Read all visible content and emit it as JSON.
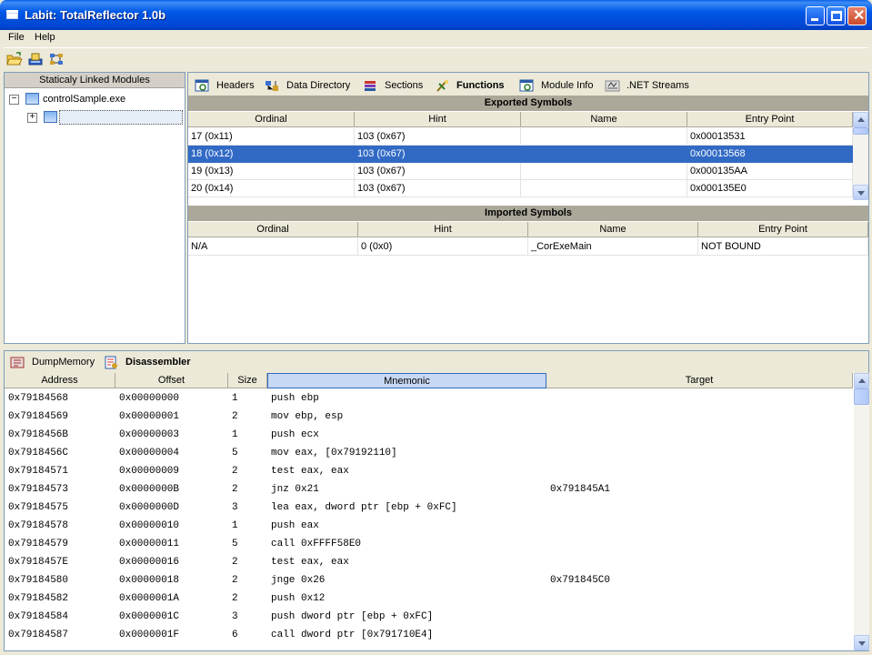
{
  "window": {
    "title": "Labit: TotalReflector 1.0b",
    "icons": {
      "app": "window-icon",
      "minimize": "minimize-icon",
      "maximize": "maximize-icon",
      "close": "close-icon"
    }
  },
  "menu": {
    "file": "File",
    "help": "Help"
  },
  "toolbar": {
    "icons": [
      "open-folder-icon",
      "load-module-icon",
      "reflect-icon"
    ]
  },
  "tree": {
    "header": "Staticaly Linked Modules",
    "root_label": "controlSample.exe",
    "root_expander": "−",
    "child_expander": "+"
  },
  "tabs": [
    {
      "label": "Headers",
      "icon": "headers-icon"
    },
    {
      "label": "Data Directory",
      "icon": "data-directory-icon"
    },
    {
      "label": "Sections",
      "icon": "sections-icon"
    },
    {
      "label": "Functions",
      "icon": "functions-icon"
    },
    {
      "label": "Module Info",
      "icon": "module-info-icon"
    },
    {
      "label": ".NET Streams",
      "icon": "net-streams-icon"
    }
  ],
  "exported": {
    "title": "Exported Symbols",
    "columns": [
      "Ordinal",
      "Hint",
      "Name",
      "Entry Point"
    ],
    "rows": [
      [
        "17 (0x11)",
        "103 (0x67)",
        "",
        "0x00013531"
      ],
      [
        "18 (0x12)",
        "103 (0x67)",
        "",
        "0x00013568"
      ],
      [
        "19 (0x13)",
        "103 (0x67)",
        "",
        "0x000135AA"
      ],
      [
        "20 (0x14)",
        "103 (0x67)",
        "",
        "0x000135E0"
      ]
    ],
    "selected_row": 1
  },
  "imported": {
    "title": "Imported Symbols",
    "columns": [
      "Ordinal",
      "Hint",
      "Name",
      "Entry Point"
    ],
    "rows": [
      [
        "N/A",
        "0 (0x0)",
        "_CorExeMain",
        "NOT BOUND"
      ]
    ]
  },
  "bottom_tabs": [
    {
      "label": "DumpMemory",
      "icon": "dump-memory-icon"
    },
    {
      "label": "Disassembler",
      "icon": "disassembler-icon"
    }
  ],
  "disasm": {
    "columns": [
      "Address",
      "Offset",
      "Size",
      "Mnemonic",
      "Target"
    ],
    "rows": [
      [
        "0x79184568",
        "0x00000000",
        "1",
        "push ebp",
        ""
      ],
      [
        "0x79184569",
        "0x00000001",
        "2",
        "mov ebp, esp",
        ""
      ],
      [
        "0x7918456B",
        "0x00000003",
        "1",
        "push ecx",
        ""
      ],
      [
        "0x7918456C",
        "0x00000004",
        "5",
        "mov eax, [0x79192110]",
        ""
      ],
      [
        "0x79184571",
        "0x00000009",
        "2",
        "test eax, eax",
        ""
      ],
      [
        "0x79184573",
        "0x0000000B",
        "2",
        "jnz 0x21",
        "0x791845A1"
      ],
      [
        "0x79184575",
        "0x0000000D",
        "3",
        "lea eax, dword ptr [ebp + 0xFC]",
        ""
      ],
      [
        "0x79184578",
        "0x00000010",
        "1",
        "push eax",
        ""
      ],
      [
        "0x79184579",
        "0x00000011",
        "5",
        "call 0xFFFF58E0",
        ""
      ],
      [
        "0x7918457E",
        "0x00000016",
        "2",
        "test eax, eax",
        ""
      ],
      [
        "0x79184580",
        "0x00000018",
        "2",
        "jnge 0x26",
        "0x791845C0"
      ],
      [
        "0x79184582",
        "0x0000001A",
        "2",
        "push 0x12",
        ""
      ],
      [
        "0x79184584",
        "0x0000001C",
        "3",
        "push dword ptr [ebp + 0xFC]",
        ""
      ],
      [
        "0x79184587",
        "0x0000001F",
        "6",
        "call dword ptr [0x791710E4]",
        ""
      ]
    ]
  }
}
